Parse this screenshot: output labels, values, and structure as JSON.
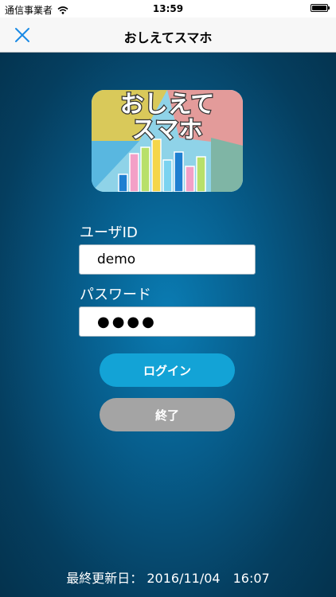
{
  "status_bar": {
    "carrier": "通信事業者",
    "time": "13:59"
  },
  "nav": {
    "title": "おしえてスマホ"
  },
  "logo": {
    "text_line1": "おしえて",
    "text_line2": "スマホ"
  },
  "form": {
    "user_label": "ユーザID",
    "user_value": "demo",
    "password_label": "パスワード",
    "password_mask": "●●●●"
  },
  "buttons": {
    "login": "ログイン",
    "exit": "終了"
  },
  "footer": {
    "last_updated": "最終更新日：  2016/11/04　16:07"
  },
  "colors": {
    "accent_blue": "#1a8ae5",
    "login_button": "#13a3d6",
    "exit_button": "#a4a4a4",
    "background": "#075f8e"
  }
}
